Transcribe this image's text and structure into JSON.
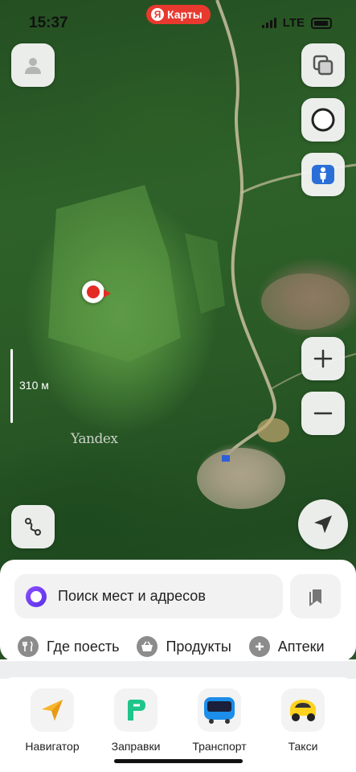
{
  "status_bar": {
    "time": "15:37",
    "network": "LTE"
  },
  "app_pill": {
    "logo": "Я",
    "label": "Карты"
  },
  "map": {
    "scale_label": "310 м",
    "watermark": "Yandex"
  },
  "search": {
    "placeholder": "Поиск мест и адресов"
  },
  "categories": [
    {
      "label": "Где поесть",
      "icon": "fork-knife-icon"
    },
    {
      "label": "Продукты",
      "icon": "basket-icon"
    },
    {
      "label": "Аптеки",
      "icon": "plus-icon"
    }
  ],
  "services": [
    {
      "label": "Навигатор",
      "icon": "navigator-icon"
    },
    {
      "label": "Заправки",
      "icon": "fuel-icon"
    },
    {
      "label": "Транспорт",
      "icon": "bus-icon"
    },
    {
      "label": "Такси",
      "icon": "taxi-icon"
    }
  ],
  "colors": {
    "accent_red": "#e8392f",
    "alice_purple": "#6b3cf0",
    "pin_red": "#e32b24"
  }
}
